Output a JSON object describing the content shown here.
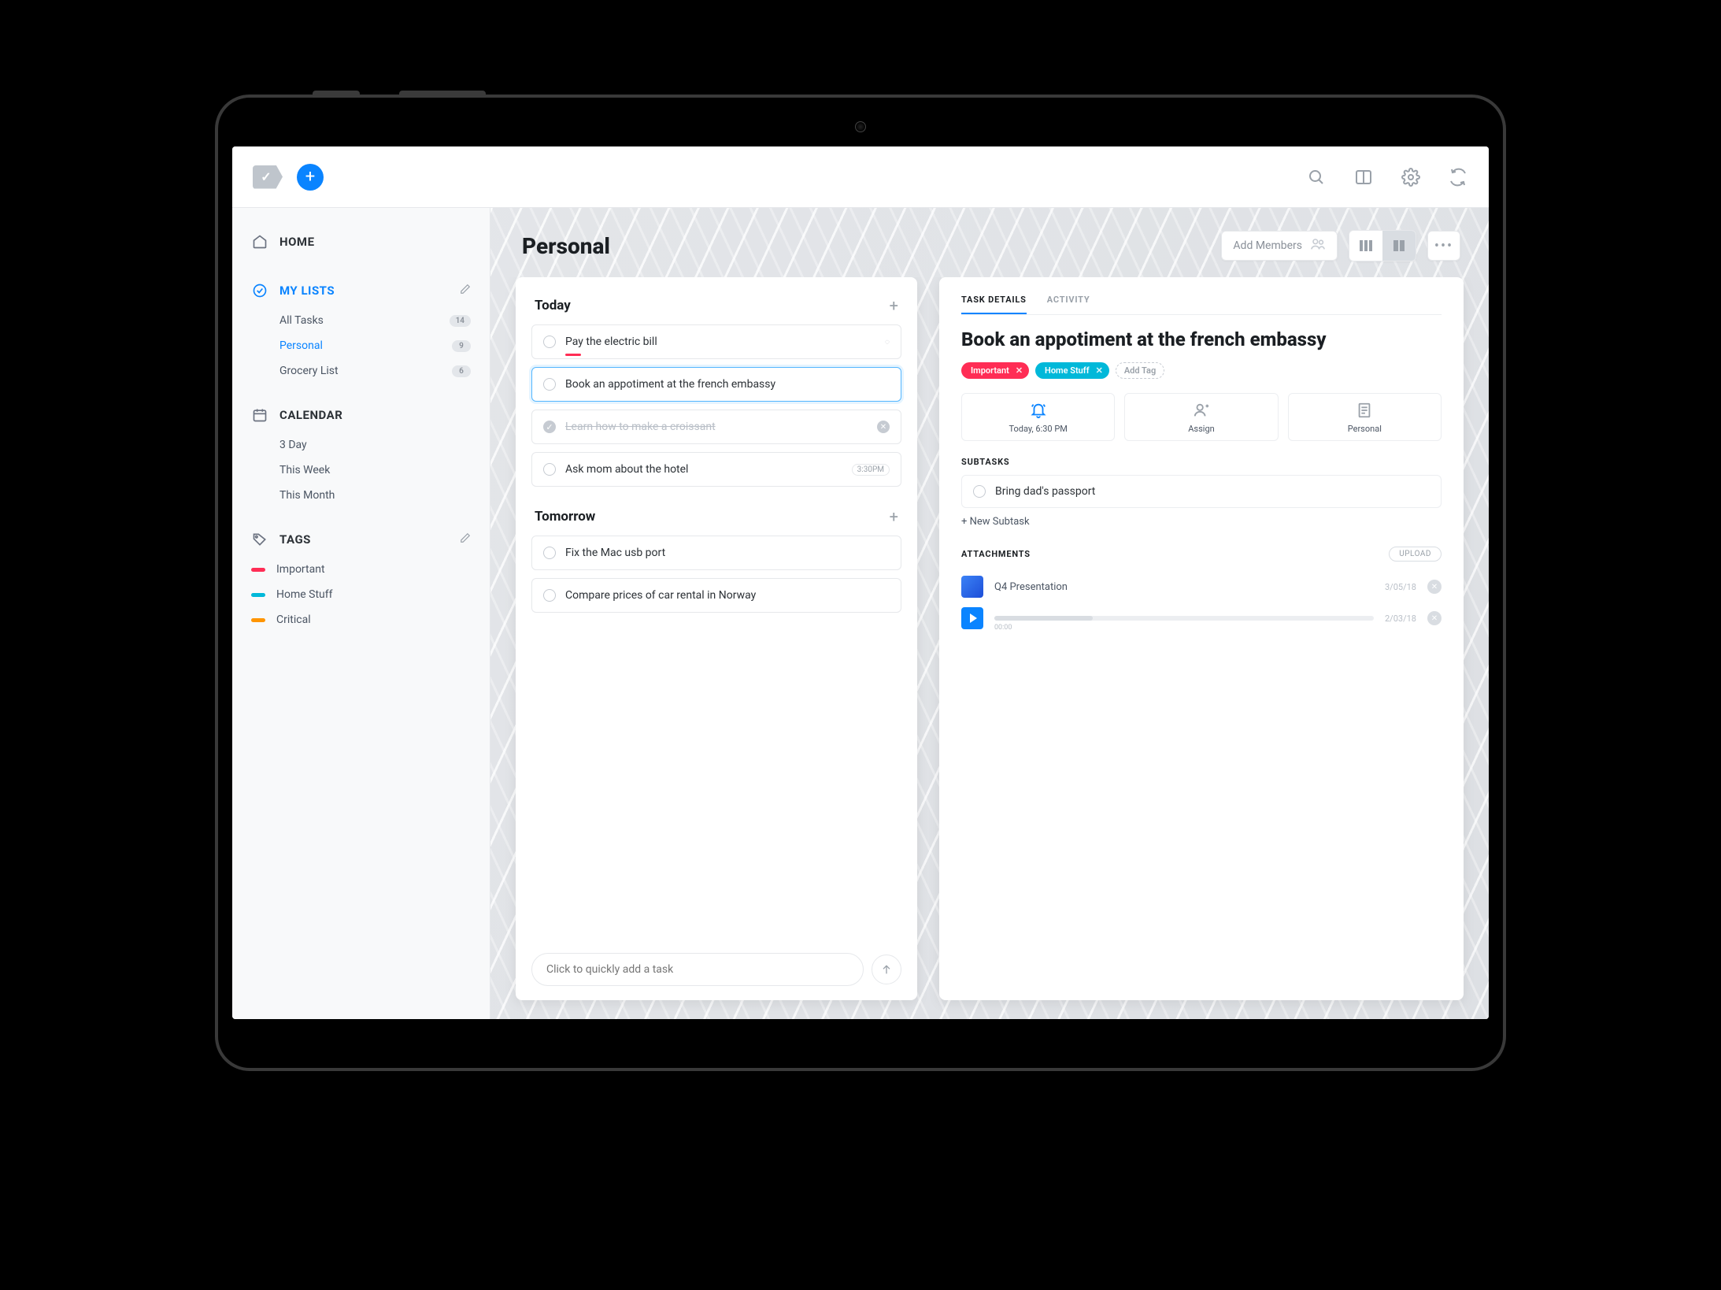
{
  "topbar": {
    "plus_label": "+"
  },
  "sidebar": {
    "home": "HOME",
    "my_lists": "MY LISTS",
    "lists": {
      "all_tasks": {
        "label": "All Tasks",
        "count": "14"
      },
      "personal": {
        "label": "Personal",
        "count": "9"
      },
      "grocery": {
        "label": "Grocery List",
        "count": "6"
      }
    },
    "calendar": "CALENDAR",
    "calendar_items": {
      "three_day": "3 Day",
      "this_week": "This Week",
      "this_month": "This Month"
    },
    "tags": "TAGS",
    "tag_items": {
      "important": {
        "label": "Important",
        "color": "#ff2d55"
      },
      "home_stuff": {
        "label": "Home Stuff",
        "color": "#00b8d9"
      },
      "critical": {
        "label": "Critical",
        "color": "#ff9500"
      }
    }
  },
  "header": {
    "title": "Personal",
    "add_members": "Add Members",
    "more": "•••"
  },
  "groups": {
    "today": {
      "title": "Today",
      "tasks": {
        "pay_bill": "Pay the electric bill",
        "book_embassy": "Book an appotiment at the french embassy",
        "croissant": "Learn how to make a croissant",
        "ask_mom": "Ask mom about the hotel",
        "ask_mom_time": "3:30PM"
      }
    },
    "tomorrow": {
      "title": "Tomorrow",
      "tasks": {
        "fix_mac": "Fix the Mac usb port",
        "car_rental": "Compare prices of car rental in Norway"
      }
    }
  },
  "quickadd": {
    "placeholder": "Click to quickly add a task"
  },
  "detail": {
    "tabs": {
      "details": "TASK DETAILS",
      "activity": "ACTIVITY"
    },
    "title": "Book an appotiment at the french embassy",
    "tags": {
      "important": "Important",
      "home_stuff": "Home Stuff",
      "add_tag": "Add Tag"
    },
    "cards": {
      "reminder": "Today, 6:30 PM",
      "assign": "Assign",
      "list": "Personal"
    },
    "subtasks_label": "SUBTASKS",
    "subtask_0": "Bring dad's passport",
    "new_subtask": "+ New Subtask",
    "attachments_label": "ATTACHMENTS",
    "upload": "UPLOAD",
    "attachments": {
      "a0": {
        "name": "Q4 Presentation",
        "date": "3/05/18"
      },
      "a1": {
        "name": "",
        "progress_label": "00:00",
        "date": "2/03/18"
      }
    }
  }
}
